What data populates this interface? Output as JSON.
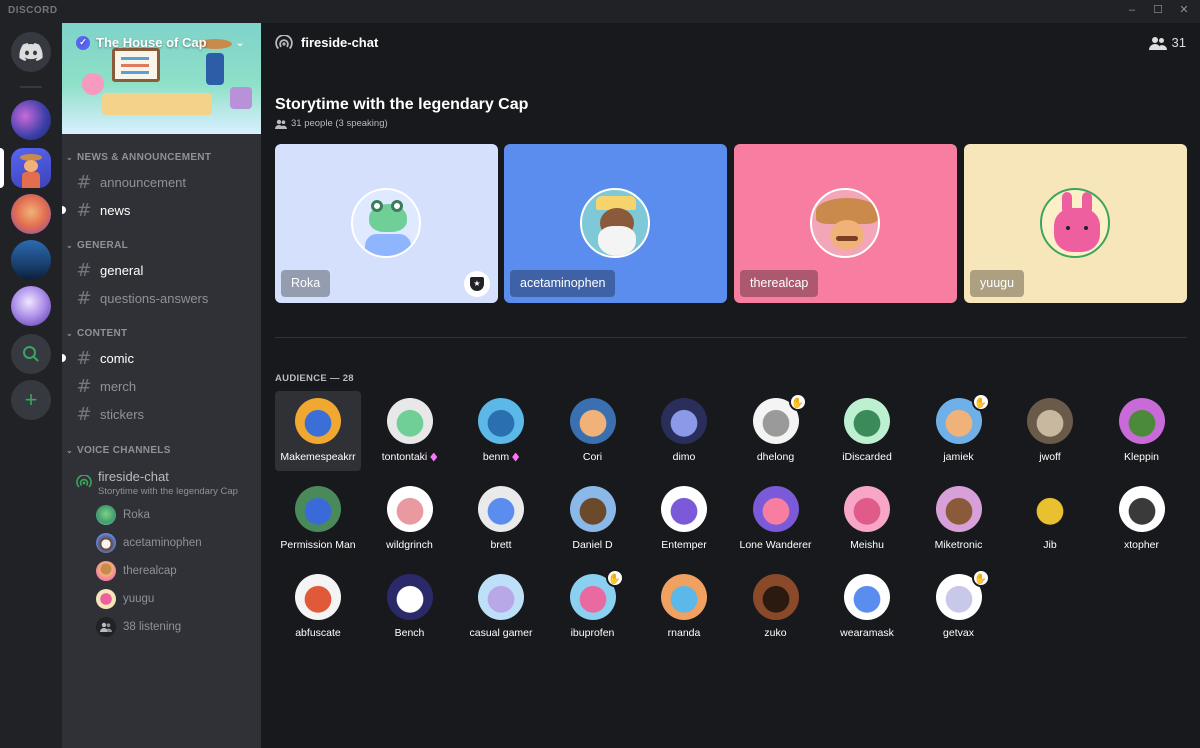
{
  "app": {
    "title": "DISCORD"
  },
  "server": {
    "name": "The House of Cap"
  },
  "categories": {
    "news": "NEWS & ANNOUNCEMENT",
    "general": "GENERAL",
    "content": "CONTENT",
    "voice": "VOICE CHANNELS"
  },
  "channels": {
    "announcement": "announcement",
    "news": "news",
    "general": "general",
    "questions": "questions-answers",
    "comic": "comic",
    "merch": "merch",
    "stickers": "stickers"
  },
  "voice_channel": {
    "name": "fireside-chat",
    "subtitle": "Storytime with the legendary Cap",
    "members": [
      "Roka",
      "acetaminophen",
      "therealcap",
      "yuugu"
    ],
    "listening": "38 listening"
  },
  "header": {
    "channel": "fireside-chat",
    "member_count": "31"
  },
  "stage": {
    "topic": "Storytime with the legendary Cap",
    "people": "31 people (3 speaking)"
  },
  "speakers": [
    {
      "name": "Roka",
      "bg": "#d4e0fc",
      "moderator": true
    },
    {
      "name": "acetaminophen",
      "bg": "#5b8def",
      "moderator": false
    },
    {
      "name": "therealcap",
      "bg": "#f77ea0",
      "moderator": false
    },
    {
      "name": "yuugu",
      "bg": "#f7e6b9",
      "moderator": false
    }
  ],
  "audience": {
    "label": "AUDIENCE — 28",
    "members": [
      "Makemespeakrr",
      "tontontaki",
      "benm",
      "Cori",
      "dimo",
      "dhelong",
      "iDiscarded",
      "jamiek",
      "jwoff",
      "Kleppin",
      "Permission Man",
      "wildgrinch",
      "brett",
      "Daniel D",
      "Entemper",
      "Lone Wanderer",
      "Meishu",
      "Miketronic",
      "Jib",
      "xtopher",
      "abfuscate",
      "Bench",
      "casual gamer",
      "ibuprofen",
      "rnanda",
      "zuko",
      "wearamask",
      "getvax"
    ]
  },
  "colors": {
    "accent": "#5865f2",
    "online": "#3ba55d",
    "boost": "#ff73fa"
  }
}
